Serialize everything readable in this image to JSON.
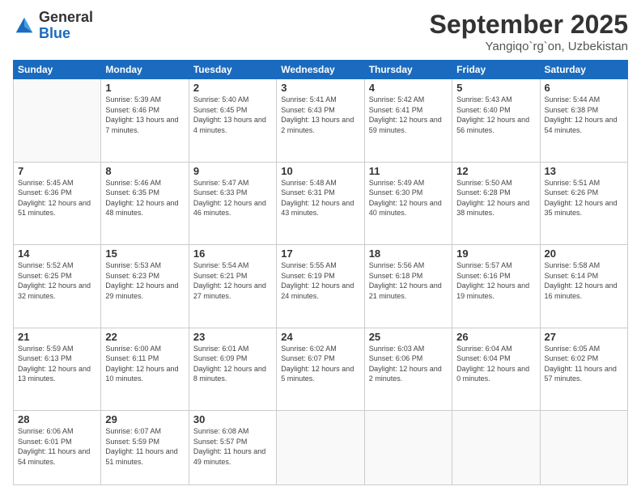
{
  "logo": {
    "general": "General",
    "blue": "Blue"
  },
  "header": {
    "month": "September 2025",
    "location": "Yangiqo`rg`on, Uzbekistan"
  },
  "weekdays": [
    "Sunday",
    "Monday",
    "Tuesday",
    "Wednesday",
    "Thursday",
    "Friday",
    "Saturday"
  ],
  "weeks": [
    [
      {
        "day": null
      },
      {
        "day": "1",
        "sunrise": "5:39 AM",
        "sunset": "6:46 PM",
        "daylight": "13 hours and 7 minutes."
      },
      {
        "day": "2",
        "sunrise": "5:40 AM",
        "sunset": "6:45 PM",
        "daylight": "13 hours and 4 minutes."
      },
      {
        "day": "3",
        "sunrise": "5:41 AM",
        "sunset": "6:43 PM",
        "daylight": "13 hours and 2 minutes."
      },
      {
        "day": "4",
        "sunrise": "5:42 AM",
        "sunset": "6:41 PM",
        "daylight": "12 hours and 59 minutes."
      },
      {
        "day": "5",
        "sunrise": "5:43 AM",
        "sunset": "6:40 PM",
        "daylight": "12 hours and 56 minutes."
      },
      {
        "day": "6",
        "sunrise": "5:44 AM",
        "sunset": "6:38 PM",
        "daylight": "12 hours and 54 minutes."
      }
    ],
    [
      {
        "day": "7",
        "sunrise": "5:45 AM",
        "sunset": "6:36 PM",
        "daylight": "12 hours and 51 minutes."
      },
      {
        "day": "8",
        "sunrise": "5:46 AM",
        "sunset": "6:35 PM",
        "daylight": "12 hours and 48 minutes."
      },
      {
        "day": "9",
        "sunrise": "5:47 AM",
        "sunset": "6:33 PM",
        "daylight": "12 hours and 46 minutes."
      },
      {
        "day": "10",
        "sunrise": "5:48 AM",
        "sunset": "6:31 PM",
        "daylight": "12 hours and 43 minutes."
      },
      {
        "day": "11",
        "sunrise": "5:49 AM",
        "sunset": "6:30 PM",
        "daylight": "12 hours and 40 minutes."
      },
      {
        "day": "12",
        "sunrise": "5:50 AM",
        "sunset": "6:28 PM",
        "daylight": "12 hours and 38 minutes."
      },
      {
        "day": "13",
        "sunrise": "5:51 AM",
        "sunset": "6:26 PM",
        "daylight": "12 hours and 35 minutes."
      }
    ],
    [
      {
        "day": "14",
        "sunrise": "5:52 AM",
        "sunset": "6:25 PM",
        "daylight": "12 hours and 32 minutes."
      },
      {
        "day": "15",
        "sunrise": "5:53 AM",
        "sunset": "6:23 PM",
        "daylight": "12 hours and 29 minutes."
      },
      {
        "day": "16",
        "sunrise": "5:54 AM",
        "sunset": "6:21 PM",
        "daylight": "12 hours and 27 minutes."
      },
      {
        "day": "17",
        "sunrise": "5:55 AM",
        "sunset": "6:19 PM",
        "daylight": "12 hours and 24 minutes."
      },
      {
        "day": "18",
        "sunrise": "5:56 AM",
        "sunset": "6:18 PM",
        "daylight": "12 hours and 21 minutes."
      },
      {
        "day": "19",
        "sunrise": "5:57 AM",
        "sunset": "6:16 PM",
        "daylight": "12 hours and 19 minutes."
      },
      {
        "day": "20",
        "sunrise": "5:58 AM",
        "sunset": "6:14 PM",
        "daylight": "12 hours and 16 minutes."
      }
    ],
    [
      {
        "day": "21",
        "sunrise": "5:59 AM",
        "sunset": "6:13 PM",
        "daylight": "12 hours and 13 minutes."
      },
      {
        "day": "22",
        "sunrise": "6:00 AM",
        "sunset": "6:11 PM",
        "daylight": "12 hours and 10 minutes."
      },
      {
        "day": "23",
        "sunrise": "6:01 AM",
        "sunset": "6:09 PM",
        "daylight": "12 hours and 8 minutes."
      },
      {
        "day": "24",
        "sunrise": "6:02 AM",
        "sunset": "6:07 PM",
        "daylight": "12 hours and 5 minutes."
      },
      {
        "day": "25",
        "sunrise": "6:03 AM",
        "sunset": "6:06 PM",
        "daylight": "12 hours and 2 minutes."
      },
      {
        "day": "26",
        "sunrise": "6:04 AM",
        "sunset": "6:04 PM",
        "daylight": "12 hours and 0 minutes."
      },
      {
        "day": "27",
        "sunrise": "6:05 AM",
        "sunset": "6:02 PM",
        "daylight": "11 hours and 57 minutes."
      }
    ],
    [
      {
        "day": "28",
        "sunrise": "6:06 AM",
        "sunset": "6:01 PM",
        "daylight": "11 hours and 54 minutes."
      },
      {
        "day": "29",
        "sunrise": "6:07 AM",
        "sunset": "5:59 PM",
        "daylight": "11 hours and 51 minutes."
      },
      {
        "day": "30",
        "sunrise": "6:08 AM",
        "sunset": "5:57 PM",
        "daylight": "11 hours and 49 minutes."
      },
      {
        "day": null
      },
      {
        "day": null
      },
      {
        "day": null
      },
      {
        "day": null
      }
    ]
  ]
}
